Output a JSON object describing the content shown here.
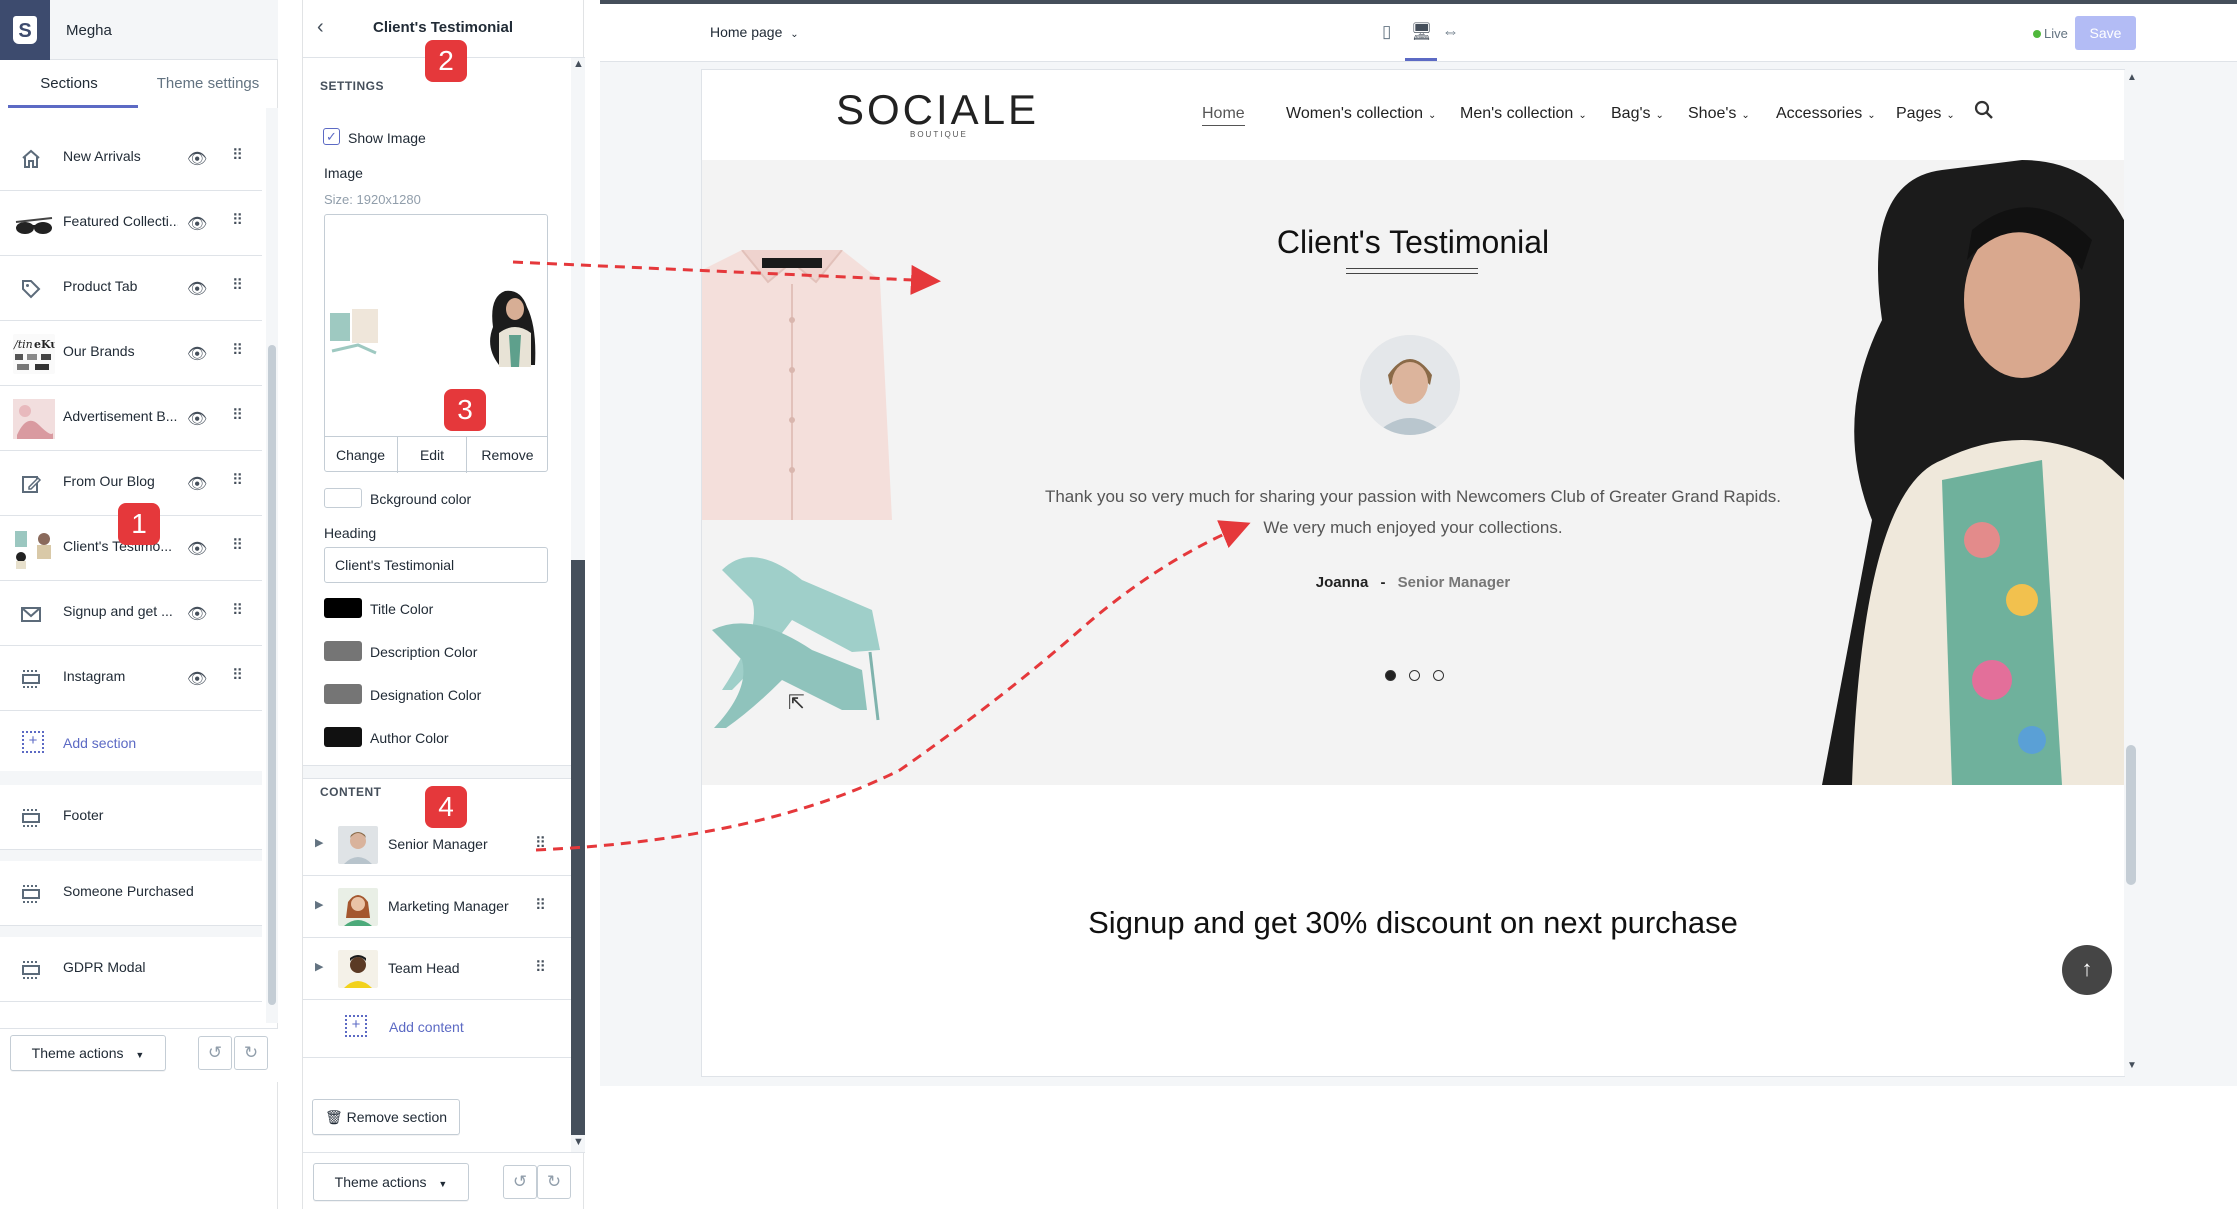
{
  "panel_sections": {
    "store_name": "Megha",
    "tabs": [
      "Sections",
      "Theme settings"
    ],
    "items": [
      {
        "label": "New Arrivals",
        "icon": "home-icon"
      },
      {
        "label": "Featured Collecti...",
        "icon": "thumbnail-sunglasses"
      },
      {
        "label": "Product Tab",
        "icon": "tag-icon"
      },
      {
        "label": "Our Brands",
        "icon": "thumbnail-brands"
      },
      {
        "label": "Advertisement B...",
        "icon": "thumbnail-advertisement"
      },
      {
        "label": "From Our Blog",
        "icon": "edit-icon"
      },
      {
        "label": "Client's Testimo...",
        "icon": "thumbnail-testimonial"
      },
      {
        "label": "Signup and get ...",
        "icon": "mail-icon"
      },
      {
        "label": "Instagram",
        "icon": "layout-icon"
      }
    ],
    "add_section_label": "Add section",
    "footer_items": [
      "Footer",
      "Someone Purchased",
      "GDPR Modal"
    ],
    "theme_actions_label": "Theme actions"
  },
  "panel_settings": {
    "title": "Client's Testimonial",
    "settings_caption": "SETTINGS",
    "show_image_label": "Show Image",
    "image_label": "Image",
    "image_size": "Size: 1920x1280",
    "image_buttons": [
      "Change",
      "Edit",
      "Remove"
    ],
    "bg_color_label": "Bckground color",
    "heading_label": "Heading",
    "heading_value": "Client's Testimonial",
    "color_fields": [
      {
        "label": "Title Color",
        "color": "#000000"
      },
      {
        "label": "Description Color",
        "color": "#757575"
      },
      {
        "label": "Designation Color",
        "color": "#757575"
      },
      {
        "label": "Author Color",
        "color": "#111111"
      }
    ],
    "content_caption": "CONTENT",
    "content_items": [
      "Senior Manager",
      "Marketing Manager",
      "Team Head"
    ],
    "add_content_label": "Add content",
    "remove_section_label": "Remove section",
    "theme_actions_label": "Theme actions"
  },
  "badges": [
    "1",
    "2",
    "3",
    "4"
  ],
  "preview": {
    "page_selector": "Home page",
    "live_label": "Live",
    "save_label": "Save",
    "site": {
      "logo": "SOCIALE",
      "logo_sub": "BOUTIQUE",
      "nav": [
        "Home",
        "Women's collection",
        "Men's collection",
        "Bag's",
        "Shoe's",
        "Accessories",
        "Pages"
      ],
      "testimonial_title": "Client's Testimonial",
      "testimonial_text_1": "Thank you so very much for sharing your passion with Newcomers Club of Greater Grand Rapids.",
      "testimonial_text_2": "We very much enjoyed your collections.",
      "author": "Joanna",
      "author_separator": "-",
      "designation": "Senior Manager",
      "signup_title": "Signup and get 30% discount on next purchase"
    }
  },
  "colors": {
    "accent": "#5c6ac4",
    "badge": "#e5383b",
    "arrow": "#e5383b",
    "save_disabled": "#b3bcf5",
    "live": "#50b83c"
  }
}
